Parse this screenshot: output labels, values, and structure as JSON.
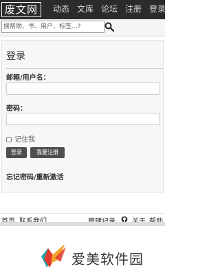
{
  "nav": {
    "logo": "废文网",
    "items": [
      "动态",
      "文库",
      "论坛",
      "注册",
      "登录"
    ]
  },
  "search": {
    "placeholder": "搜帮助、书、用户、标签...?"
  },
  "login": {
    "title": "登录",
    "email_label": "邮箱/用户名：",
    "password_label": "密码：",
    "remember_label": "记住我",
    "login_button": "登录",
    "register_button": "我要注册",
    "forgot_link": "忘记密码/重新激活"
  },
  "footer": {
    "home": "首页",
    "contact": "联系我们",
    "admin_log": "管理记录",
    "about": "关于",
    "help": "帮助"
  },
  "watermark": {
    "text": "爱美软件园",
    "colors": [
      "#e03a2f",
      "#f2a32c",
      "#1ea6a8",
      "#333333"
    ]
  }
}
